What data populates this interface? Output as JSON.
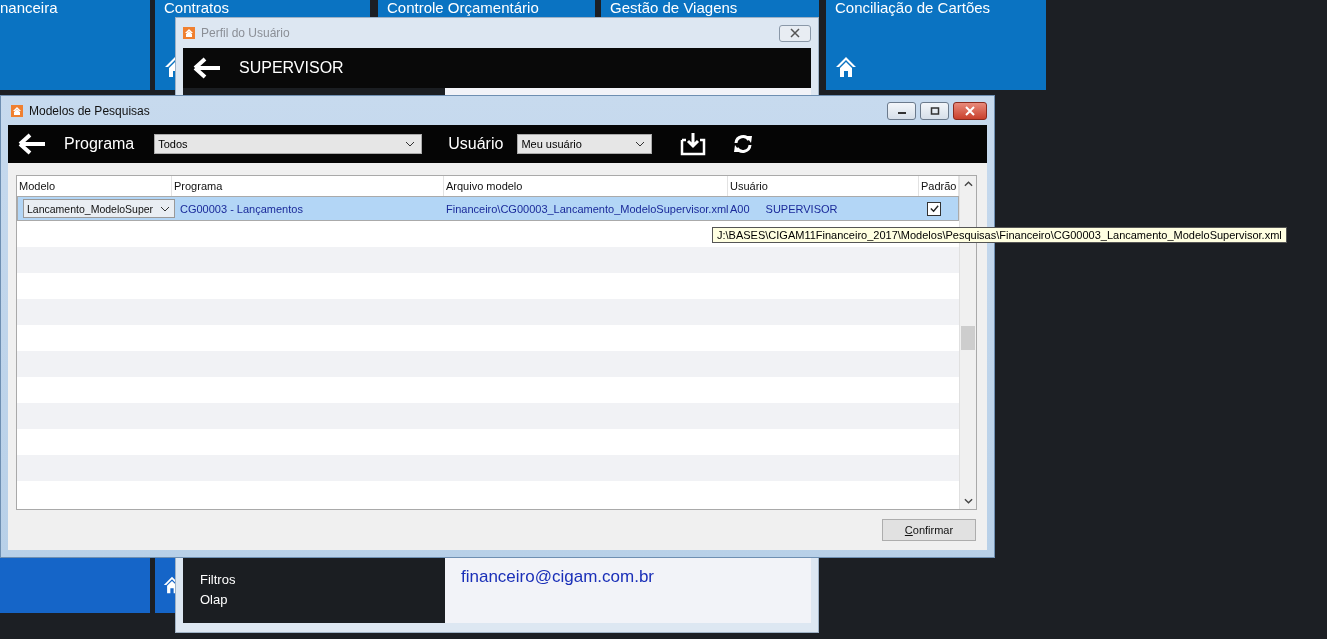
{
  "tiles_top": [
    {
      "label": "nanceira",
      "icon": false
    },
    {
      "label": "Contratos",
      "icon": true
    },
    {
      "label": "Controle Orçamentário"
    },
    {
      "label": "Gestão de Viagens"
    },
    {
      "label": "Conciliação de Cartões",
      "icon": true
    }
  ],
  "tiles_bottom": [
    {
      "icon": false
    },
    {
      "icon": true
    }
  ],
  "profile_window": {
    "title": "Perfil do Usuário",
    "user": "SUPERVISOR",
    "menu_items": [
      "Filtros",
      "Olap"
    ],
    "email": "financeiro@cigam.com.br"
  },
  "models_window": {
    "title": "Modelos de Pesquisas",
    "toolbar": {
      "program_label": "Programa",
      "program_value": "Todos",
      "user_label": "Usuário",
      "user_value": "Meu usuário"
    },
    "table": {
      "columns": [
        "Modelo",
        "Programa",
        "Arquivo modelo",
        "Usuário",
        "Padrão"
      ],
      "rows": [
        {
          "modelo": "Lancamento_ModeloSuper",
          "programa": "CG00003 - Lançamentos",
          "arquivo": "Financeiro\\CG00003_Lancamento_ModeloSupervisor.xml",
          "usuario_code": "A00",
          "usuario_name": "SUPERVISOR",
          "padrao": true,
          "selected": true
        }
      ]
    },
    "tooltip": "J:\\BASES\\CIGAM11Financeiro_2017\\Modelos\\Pesquisas\\Financeiro\\CG00003_Lancamento_ModeloSupervisor.xml",
    "confirm_button": "Confirmar"
  }
}
